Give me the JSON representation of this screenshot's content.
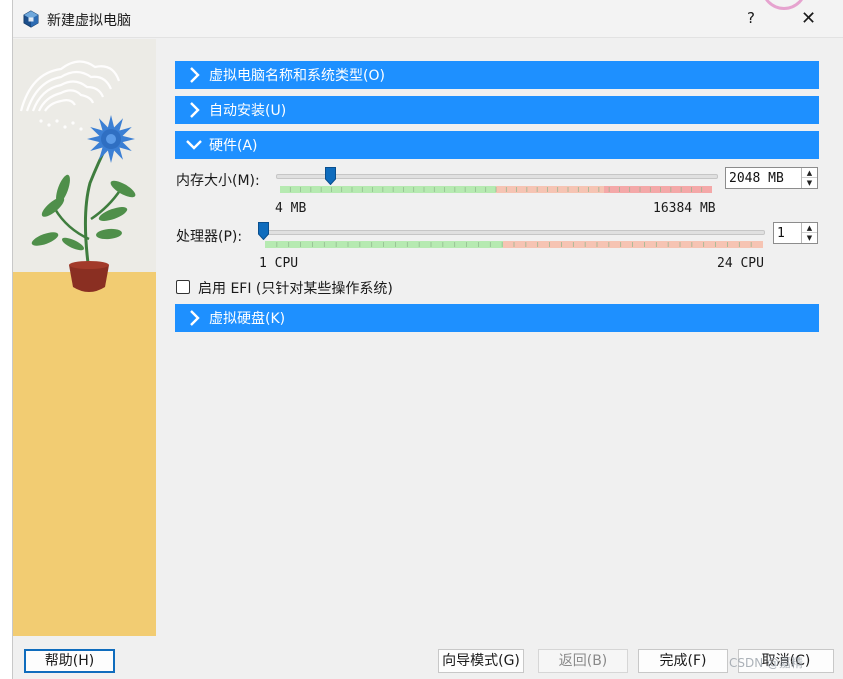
{
  "window": {
    "title": "新建虚拟电脑",
    "help_label": "?",
    "close_label": "✕"
  },
  "sections": [
    {
      "label": "虚拟电脑名称和系统类型(O)",
      "state": "collapsed"
    },
    {
      "label": "自动安装(U)",
      "state": "collapsed"
    },
    {
      "label": "硬件(A)",
      "state": "expanded"
    },
    {
      "label": "虚拟硬盘(K)",
      "state": "collapsed"
    }
  ],
  "hardware": {
    "memory": {
      "label": "内存大小(M):",
      "value": "2048 MB",
      "min_label": "4 MB",
      "max_label": "16384 MB",
      "min": 4,
      "max": 16384,
      "current": 2048,
      "recommended_max": 8192,
      "warn_max": 12288
    },
    "processor": {
      "label": "处理器(P):",
      "value": "1",
      "min_label": "1 CPU",
      "max_label": "24 CPU",
      "min": 1,
      "max": 24,
      "current": 1,
      "recommended_max": 12
    },
    "efi": {
      "label": "启用 EFI (只针对某些操作系统)",
      "checked": false
    }
  },
  "buttons": {
    "help": "帮助(H)",
    "guided": "向导模式(G)",
    "back": "返回(B)",
    "finish": "完成(F)",
    "cancel": "取消(C)"
  },
  "watermark": "CSDN @嘉精",
  "colors": {
    "section_header": "#1e90ff",
    "good_range": "#b6eab1",
    "warn_range": "#f6c4b3",
    "bad_range": "#f4a8a8",
    "accent": "#0f6cbd"
  },
  "icons": {
    "app": "virtualbox-cube-icon",
    "collapsed": "chevron-right-icon",
    "expanded": "chevron-down-icon"
  }
}
